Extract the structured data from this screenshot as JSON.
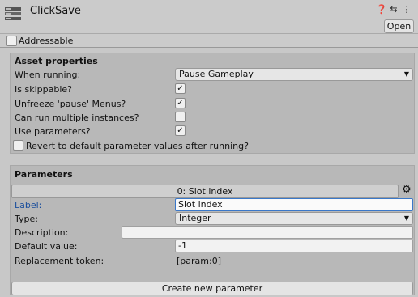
{
  "header": {
    "title": "ClickSave",
    "icons": [
      "help-icon",
      "presets-icon",
      "menu-icon"
    ],
    "open_label": "Open"
  },
  "addressable": {
    "label": "Addressable",
    "checked": false
  },
  "asset_properties": {
    "title": "Asset properties",
    "when_running": {
      "label": "When running:",
      "value": "Pause Gameplay"
    },
    "is_skippable": {
      "label": "Is skippable?",
      "checked": true
    },
    "unfreeze_pause_menus": {
      "label": "Unfreeze 'pause' Menus?",
      "checked": true
    },
    "multiple_instances": {
      "label": "Can run multiple instances?",
      "checked": false
    },
    "use_parameters": {
      "label": "Use parameters?",
      "checked": true
    },
    "revert_defaults": {
      "label": "Revert to default parameter values after running?",
      "checked": false
    }
  },
  "parameters": {
    "title": "Parameters",
    "slot_header": "0: Slot index",
    "label": {
      "label": "Label:",
      "value": "Slot index"
    },
    "type": {
      "label": "Type:",
      "value": "Integer"
    },
    "description": {
      "label": "Description:",
      "value": ""
    },
    "default_value": {
      "label": "Default value:",
      "value": "-1"
    },
    "replacement_token": {
      "label": "Replacement token:",
      "value": "[param:0]"
    },
    "create_label": "Create new parameter"
  },
  "check_glyph": "✓"
}
